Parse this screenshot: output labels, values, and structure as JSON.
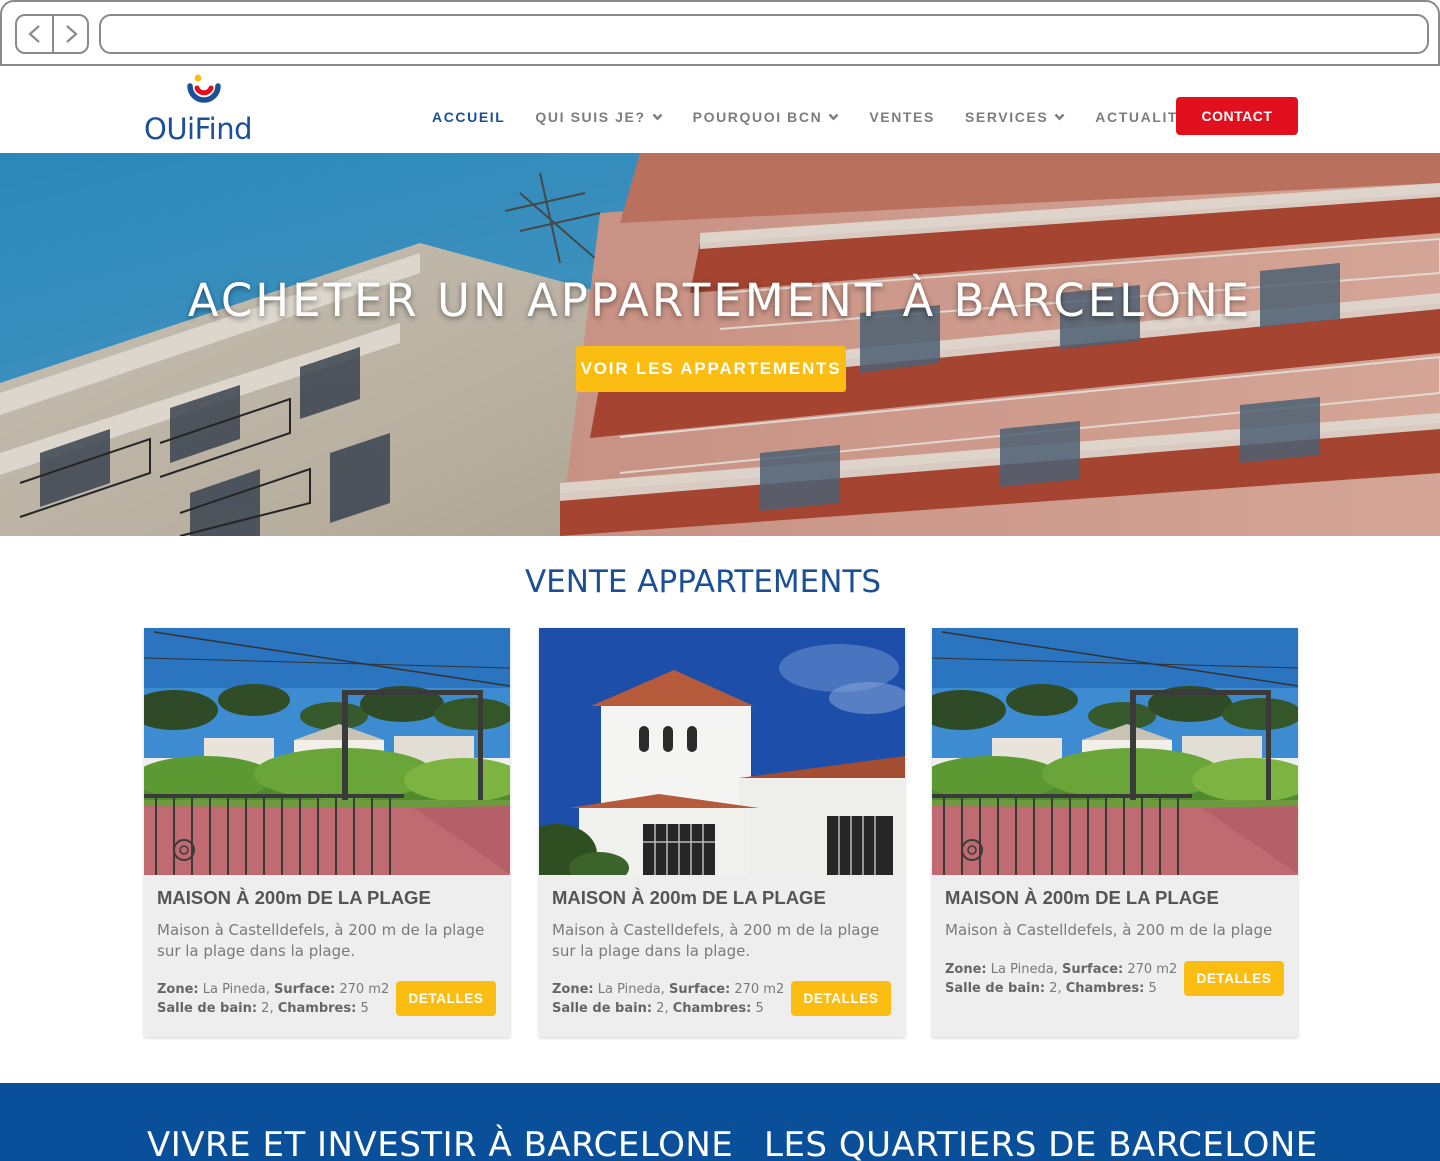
{
  "brand": {
    "name": "OUiFind",
    "blue": "#1b4f96",
    "red": "#e2101e",
    "yellow": "#fbbd11",
    "band_blue": "#0a4f9a"
  },
  "nav": {
    "items": [
      {
        "label": "ACCUEIL",
        "active": true,
        "dropdown": false
      },
      {
        "label": "QUI SUIS JE?",
        "active": false,
        "dropdown": true
      },
      {
        "label": "POURQUOI BCN",
        "active": false,
        "dropdown": true
      },
      {
        "label": "VENTES",
        "active": false,
        "dropdown": false
      },
      {
        "label": "SERVICES",
        "active": false,
        "dropdown": true
      },
      {
        "label": "ACTUALITÉS",
        "active": false,
        "dropdown": false
      }
    ],
    "contact_label": "CONTACT"
  },
  "hero": {
    "title": "ACHETER UN APPARTEMENT À BARCELONE",
    "button_label": "VOIR LES APPARTEMENTS"
  },
  "listings": {
    "section_title": "VENTE APPARTEMENTS",
    "details_label": "DETALLES",
    "zone_label": "Zone:",
    "surface_label": "Surface:",
    "bath_label": "Salle de bain:",
    "rooms_label": "Chambres:",
    "cards": [
      {
        "title": "MAISON À 200m DE LA PLAGE",
        "description": "Maison à Castelldefels, à 200 m de la plage sur la plage dans la plage.",
        "zone": "La Pineda,",
        "surface": "270 m2",
        "baths": "2,",
        "rooms": "5",
        "image": "garden-pines"
      },
      {
        "title": "MAISON À 200m DE LA PLAGE",
        "description": "Maison à Castelldefels, à 200 m de la plage sur la plage dans la plage.",
        "zone": "La Pineda,",
        "surface": "270 m2",
        "baths": "2,",
        "rooms": "5",
        "image": "white-villa"
      },
      {
        "title": "MAISON À 200m DE LA PLAGE",
        "description": "Maison à Castelldefels, à 200 m de la plage",
        "zone": "La Pineda,",
        "surface": "270 m2",
        "baths": "2,",
        "rooms": "5",
        "image": "garden-pines"
      }
    ]
  },
  "band": {
    "left_title": "VIVRE ET INVESTIR À BARCELONE",
    "right_title": "LES QUARTIERS DE BARCELONE"
  }
}
